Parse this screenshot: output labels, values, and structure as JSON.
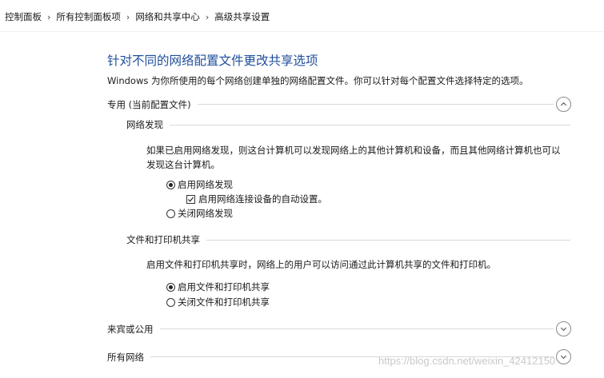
{
  "breadcrumb": {
    "items": [
      "控制面板",
      "所有控制面板项",
      "网络和共享中心",
      "高级共享设置"
    ],
    "separator": "›"
  },
  "page": {
    "title": "针对不同的网络配置文件更改共享选项",
    "intro": "Windows 为你所使用的每个网络创建单独的网络配置文件。你可以针对每个配置文件选择特定的选项。"
  },
  "profiles": {
    "private": {
      "label": "专用 (当前配置文件)",
      "expanded": true,
      "network_discovery": {
        "label": "网络发现",
        "description": "如果已启用网络发现，则这台计算机可以发现网络上的其他计算机和设备，而且其他网络计算机也可以发现这台计算机。",
        "enable_label": "启用网络发现",
        "enable_selected": true,
        "auto_setup_label": "启用网络连接设备的自动设置。",
        "auto_setup_checked": true,
        "disable_label": "关闭网络发现",
        "disable_selected": false
      },
      "file_printer_sharing": {
        "label": "文件和打印机共享",
        "description": "启用文件和打印机共享时，网络上的用户可以访问通过此计算机共享的文件和打印机。",
        "enable_label": "启用文件和打印机共享",
        "enable_selected": true,
        "disable_label": "关闭文件和打印机共享",
        "disable_selected": false
      }
    },
    "guest_public": {
      "label": "来宾或公用",
      "expanded": false
    },
    "all_networks": {
      "label": "所有网络",
      "expanded": false
    }
  },
  "icons": {
    "expanded": "chevron-up-icon",
    "collapsed": "chevron-down-icon"
  },
  "watermark": "https://blog.csdn.net/weixin_42412150",
  "colors": {
    "title": "#1f4e9c",
    "rule": "#d9d9d9"
  }
}
